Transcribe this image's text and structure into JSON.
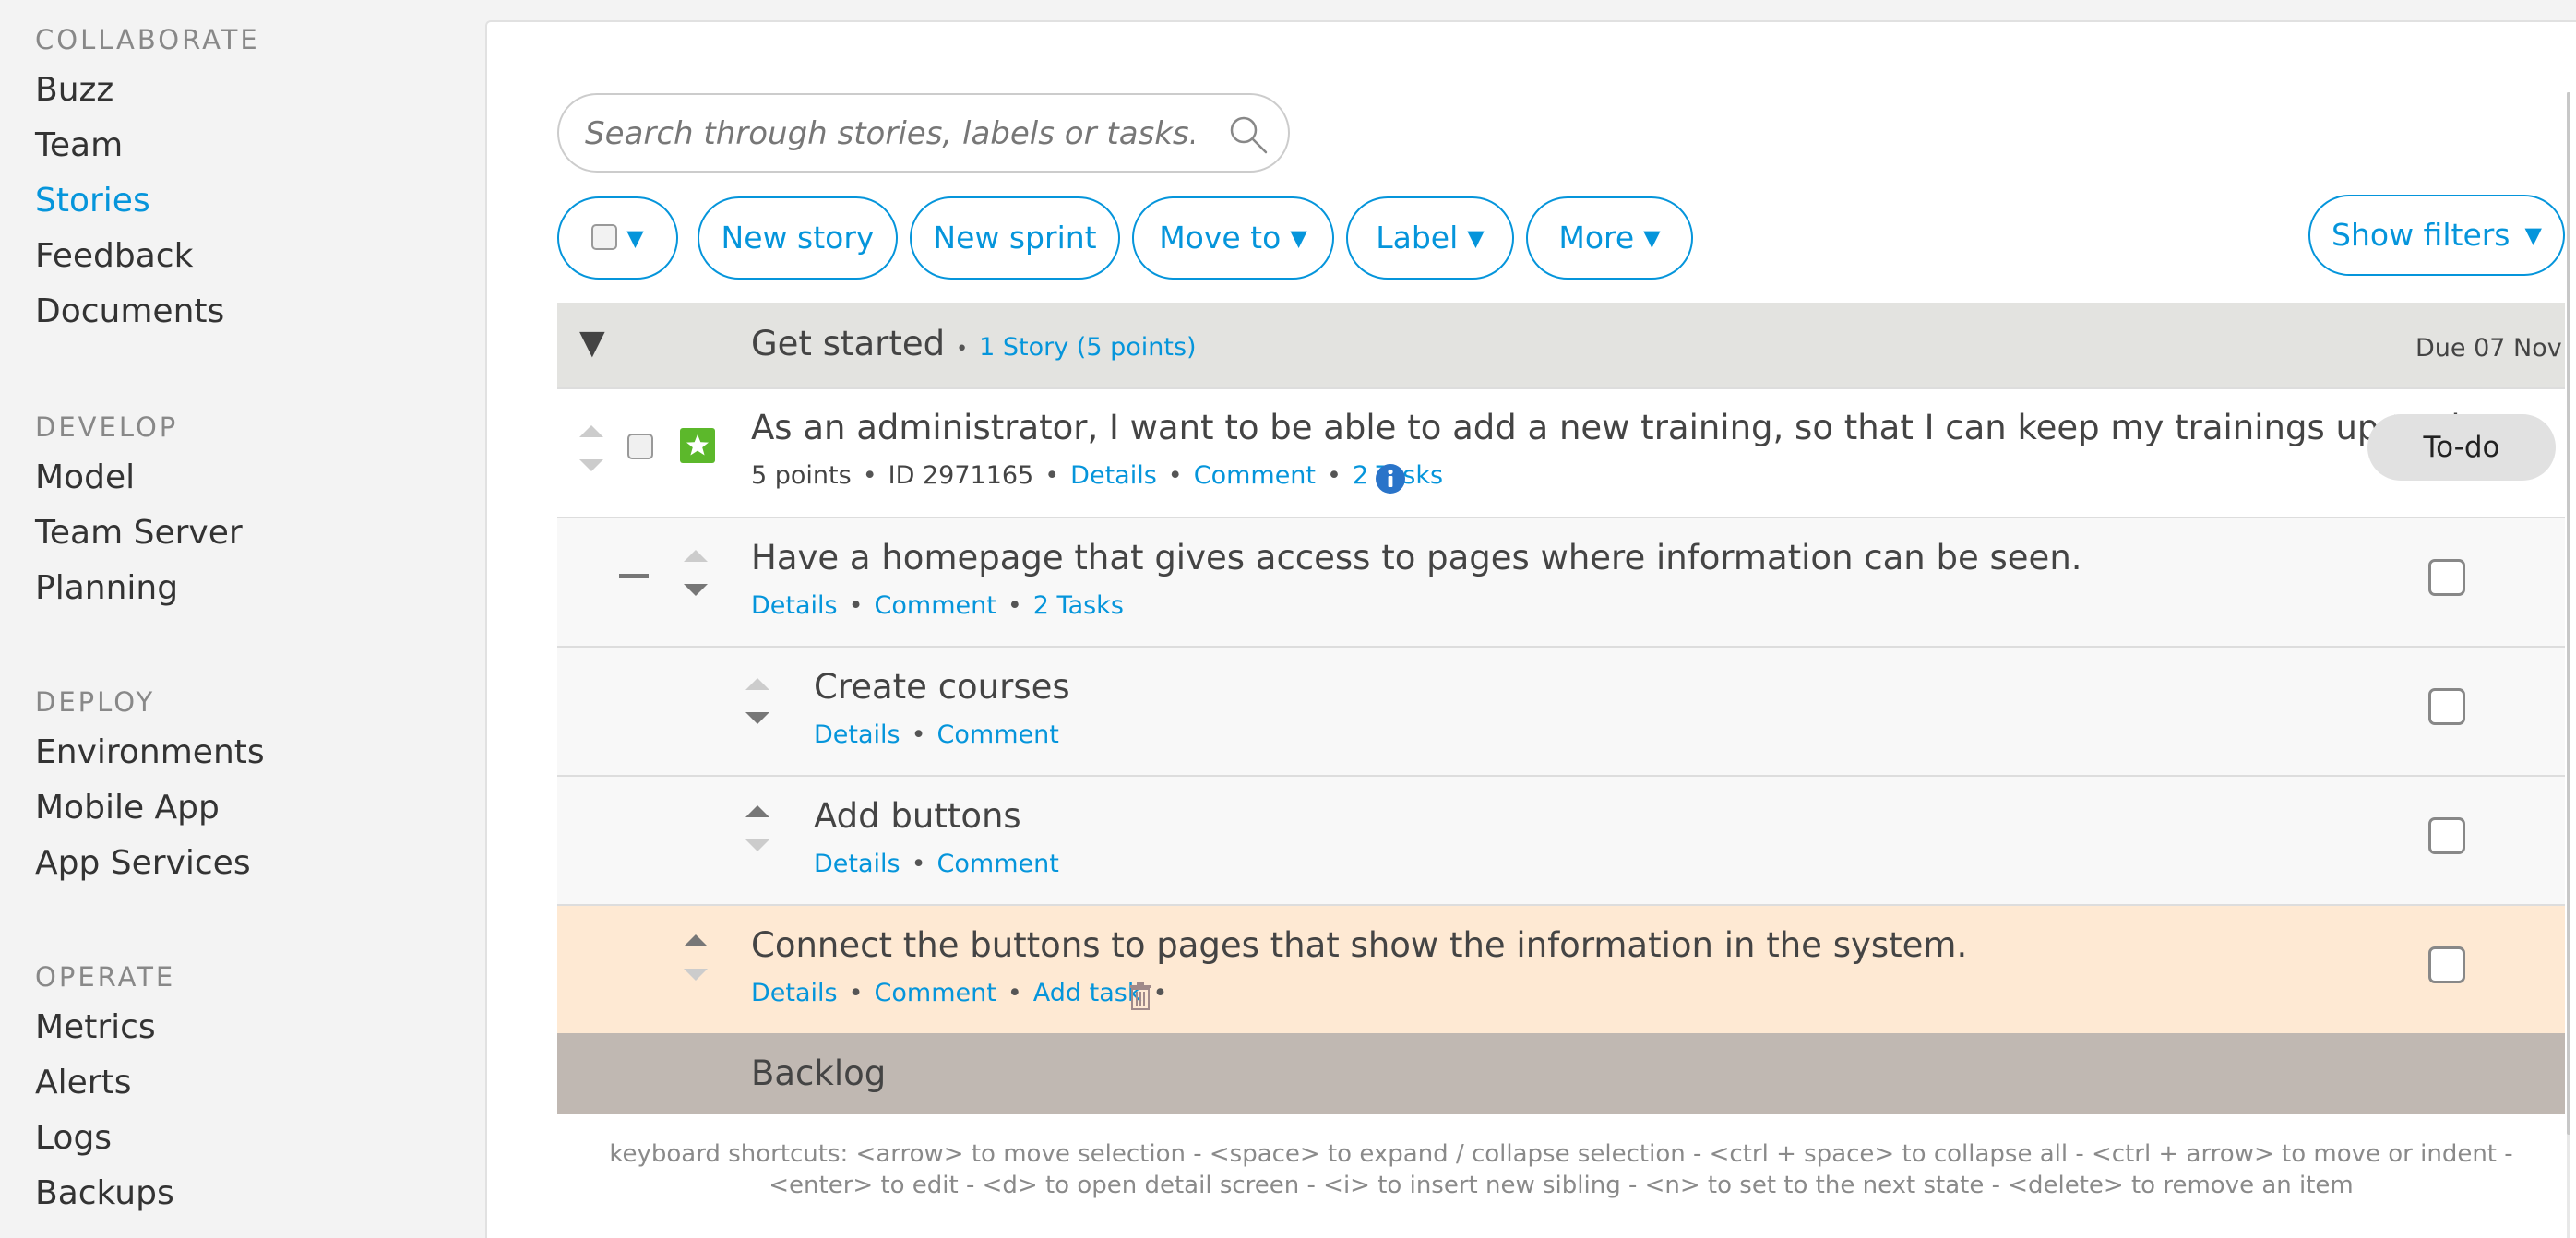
{
  "sidebar": {
    "sections": [
      {
        "heading": "COLLABORATE",
        "items": [
          {
            "label": "Buzz"
          },
          {
            "label": "Team"
          },
          {
            "label": "Stories",
            "active": true
          },
          {
            "label": "Feedback"
          },
          {
            "label": "Documents"
          }
        ]
      },
      {
        "heading": "DEVELOP",
        "items": [
          {
            "label": "Model"
          },
          {
            "label": "Team Server"
          },
          {
            "label": "Planning"
          }
        ]
      },
      {
        "heading": "DEPLOY",
        "items": [
          {
            "label": "Environments"
          },
          {
            "label": "Mobile App"
          },
          {
            "label": "App Services"
          }
        ]
      },
      {
        "heading": "OPERATE",
        "items": [
          {
            "label": "Metrics"
          },
          {
            "label": "Alerts"
          },
          {
            "label": "Logs"
          },
          {
            "label": "Backups"
          }
        ]
      }
    ]
  },
  "search": {
    "placeholder": "Search through stories, labels or tasks..."
  },
  "toolbar": {
    "select_caret": "▼",
    "new_story": "New story",
    "new_sprint": "New sprint",
    "move_to": "Move to",
    "label": "Label",
    "more": "More",
    "show_filters": "Show filters",
    "caret": "▼"
  },
  "group": {
    "toggle": "▼",
    "title": "Get started",
    "summary": "1 Story (5 points)",
    "due": "Due 07 Nov"
  },
  "story": {
    "title": "As an administrator, I want to be able to add a new training, so that I can keep my trainings up-to-date.",
    "points": "5 points",
    "id_label": "ID",
    "id_value": "2971165",
    "details": "Details",
    "comment": "Comment",
    "tasks": "2 Tasks",
    "status": "To-do"
  },
  "tasks": [
    {
      "title": "Have a homepage that gives access to pages where information can be seen.",
      "details": "Details",
      "comment": "Comment",
      "tasks": "2 Tasks"
    },
    {
      "title": "Create courses",
      "details": "Details",
      "comment": "Comment"
    },
    {
      "title": "Add buttons",
      "details": "Details",
      "comment": "Comment"
    },
    {
      "title": "Connect the buttons to pages that show the information in the system.",
      "details": "Details",
      "comment": "Comment",
      "add_task": "Add task"
    }
  ],
  "backlog": {
    "title": "Backlog"
  },
  "footer": {
    "shortcuts": "keyboard shortcuts: <arrow> to move selection - <space> to expand / collapse selection - <ctrl + space> to collapse all - <ctrl + arrow> to move or indent - <enter> to edit - <d> to open detail screen - <i> to insert new sibling - <n> to set to the next state - <delete> to remove an item"
  },
  "colors": {
    "accent": "#0595db",
    "star_badge": "#5cb82b",
    "highlight_row": "#fee9d3",
    "backlog_bar": "#c0b8b2",
    "group_bar": "#e3e3e0",
    "info_icon": "#2a74c9"
  }
}
